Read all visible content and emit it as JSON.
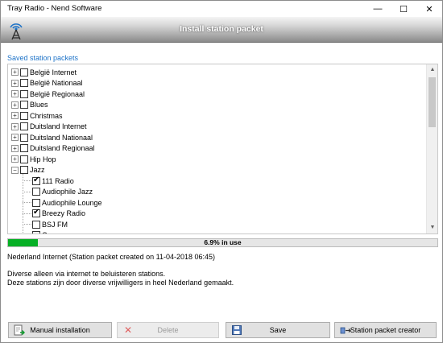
{
  "window": {
    "title": "Tray Radio - Nend Software",
    "minimize_glyph": "—",
    "maximize_glyph": "☐",
    "close_glyph": "✕"
  },
  "header": {
    "title": "Install station packet",
    "logo_icon": "radio-tower-icon"
  },
  "section_label": "Saved station packets",
  "tree": {
    "items": [
      {
        "label": "België Internet",
        "level": 0,
        "expander": "+",
        "checked": false
      },
      {
        "label": "België Nationaal",
        "level": 0,
        "expander": "+",
        "checked": false
      },
      {
        "label": "België Regionaal",
        "level": 0,
        "expander": "+",
        "checked": false
      },
      {
        "label": "Blues",
        "level": 0,
        "expander": "+",
        "checked": false
      },
      {
        "label": "Christmas",
        "level": 0,
        "expander": "+",
        "checked": false
      },
      {
        "label": "Duitsland Internet",
        "level": 0,
        "expander": "+",
        "checked": false
      },
      {
        "label": "Duitsland Nationaal",
        "level": 0,
        "expander": "+",
        "checked": false
      },
      {
        "label": "Duitsland Regionaal",
        "level": 0,
        "expander": "+",
        "checked": false
      },
      {
        "label": "Hip Hop",
        "level": 0,
        "expander": "+",
        "checked": false
      },
      {
        "label": "Jazz",
        "level": 0,
        "expander": "−",
        "checked": false
      },
      {
        "label": "111 Radio",
        "level": 1,
        "expander": "",
        "checked": true
      },
      {
        "label": "Audiophile Jazz",
        "level": 1,
        "expander": "",
        "checked": false
      },
      {
        "label": "Audiophile Lounge",
        "level": 1,
        "expander": "",
        "checked": false
      },
      {
        "label": "Breezy Radio",
        "level": 1,
        "expander": "",
        "checked": true
      },
      {
        "label": "BSJ FM",
        "level": 1,
        "expander": "",
        "checked": false
      },
      {
        "label": "Crooze",
        "level": 1,
        "expander": "",
        "checked": false
      }
    ]
  },
  "usage": {
    "label": "6.9% in use",
    "fraction": 0.069,
    "color": "#06b025"
  },
  "info": {
    "packet": "Nederland Internet (Station packet created on 11-04-2018 06:45)",
    "description_line1": "Diverse alleen via internet te beluisteren stations.",
    "description_line2": "Deze stations zijn door diverse vrijwilligers in heel Nederland gemaakt."
  },
  "buttons": {
    "manual": "Manual installation",
    "delete": "Delete",
    "save": "Save",
    "creator": "Station packet creator"
  },
  "colors": {
    "accent": "#1e73c8"
  }
}
